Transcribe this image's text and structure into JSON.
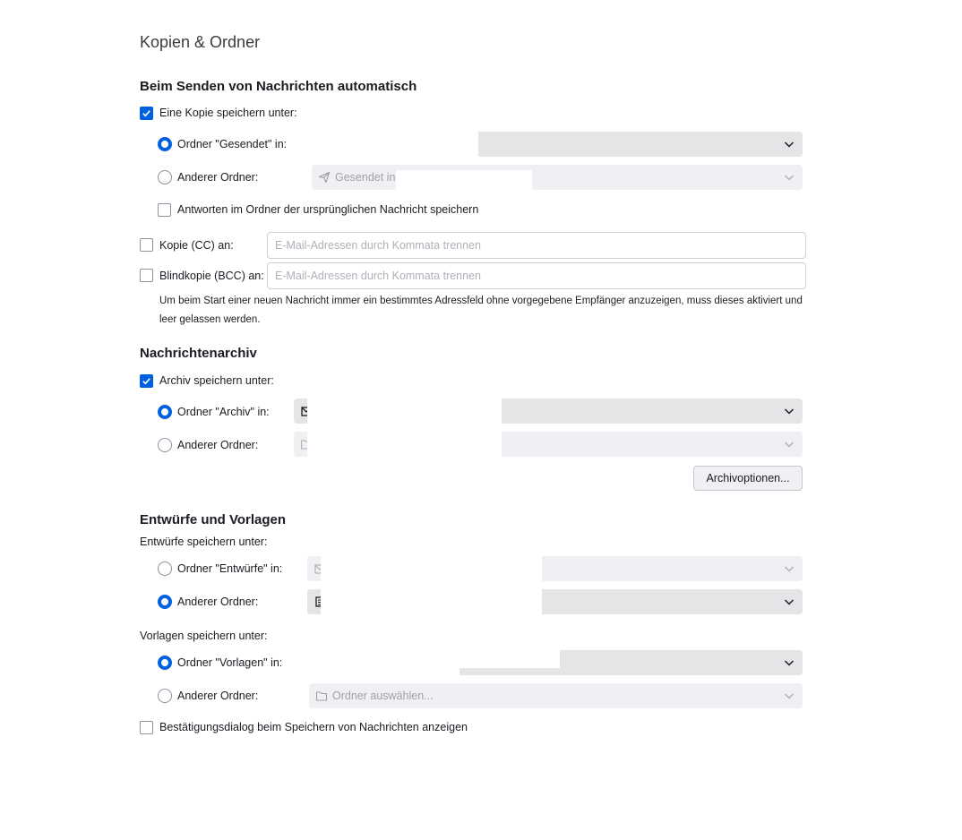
{
  "page": {
    "title": "Kopien & Ordner"
  },
  "send": {
    "heading": "Beim Senden von Nachrichten automatisch",
    "save_copy_label": "Eine Kopie speichern unter:",
    "save_copy_checked": true,
    "sent_folder_radio_label": "Ordner \"Gesendet\" in:",
    "other_folder_radio_label": "Anderer Ordner:",
    "other_folder_value": "Gesendet in",
    "reply_in_folder_label": "Antworten im Ordner der ursprünglichen Nachricht speichern",
    "cc_label": "Kopie (CC) an:",
    "cc_placeholder": "E-Mail-Adressen durch Kommata trennen",
    "bcc_label": "Blindkopie (BCC) an:",
    "bcc_placeholder": "E-Mail-Adressen durch Kommata trennen",
    "hint": "Um beim Start einer neuen Nachricht immer ein bestimmtes Adressfeld ohne vorgegebene Empfänger anzuzeigen, muss dieses aktiviert und leer gelassen werden."
  },
  "archive": {
    "heading": "Nachrichtenarchiv",
    "save_archive_label": "Archiv speichern unter:",
    "save_archive_checked": true,
    "archive_folder_radio_label": "Ordner \"Archiv\" in:",
    "other_folder_radio_label": "Anderer Ordner:",
    "options_button": "Archivoptionen..."
  },
  "drafts": {
    "heading": "Entwürfe und Vorlagen",
    "drafts_label": "Entwürfe speichern unter:",
    "drafts_folder_radio_label": "Ordner \"Entwürfe\" in:",
    "drafts_other_radio_label": "Anderer Ordner:",
    "templates_label": "Vorlagen speichern unter:",
    "templates_folder_radio_label": "Ordner \"Vorlagen\" in:",
    "templates_other_radio_label": "Anderer Ordner:",
    "templates_other_value": "Ordner auswählen...",
    "confirm_label": "Bestätigungsdialog beim Speichern von Nachrichten anzeigen"
  },
  "icons": {
    "check": "checkmark-icon",
    "chevron": "chevron-down-icon",
    "send": "paper-plane-icon",
    "folder": "folder-icon"
  },
  "colors": {
    "accent": "#0061e0"
  }
}
